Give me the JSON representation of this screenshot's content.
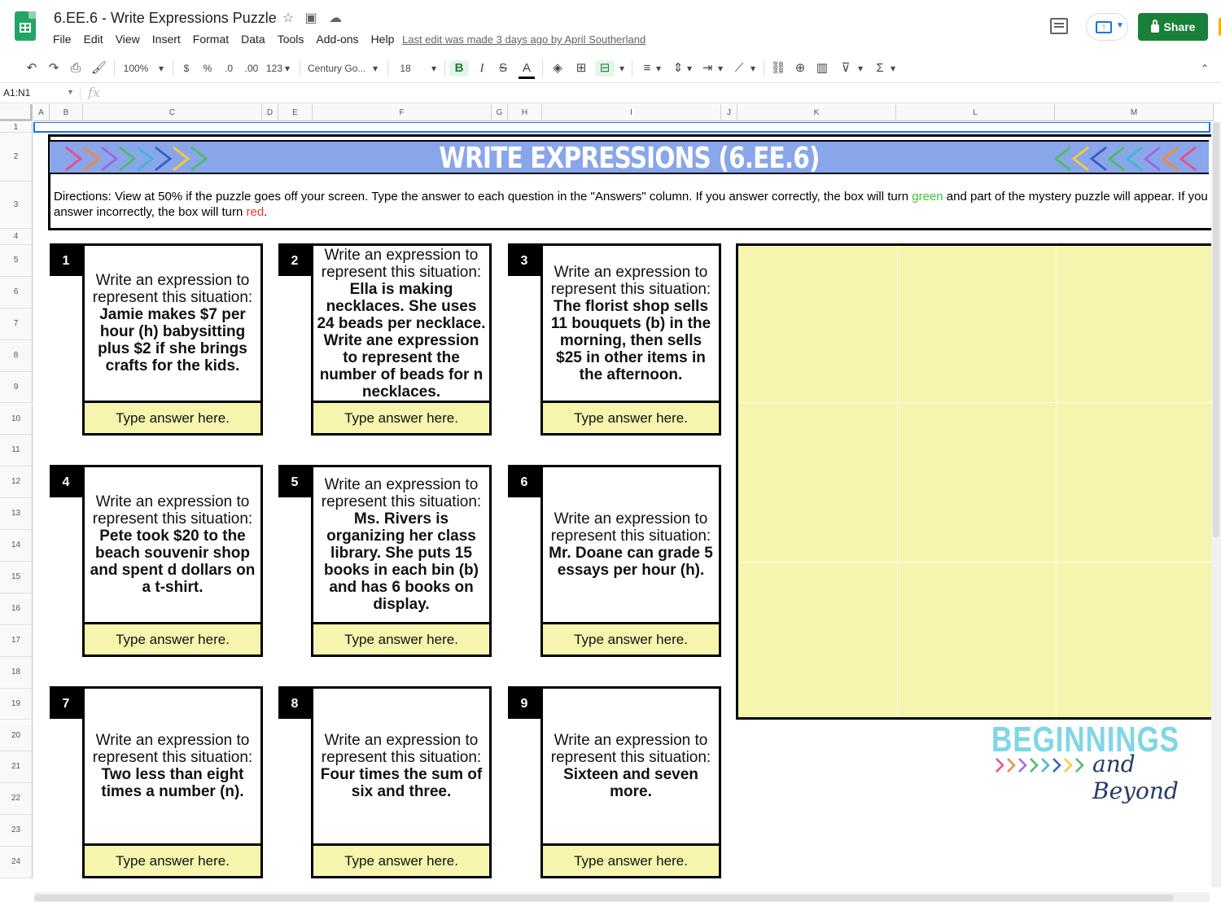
{
  "window": {
    "doc_title": "6.EE.6 - Write Expressions Puzzle",
    "menu": [
      "File",
      "Edit",
      "View",
      "Insert",
      "Format",
      "Data",
      "Tools",
      "Add-ons",
      "Help"
    ],
    "last_edit": "Last edit was made 3 days ago by April Southerland",
    "share_label": "Share",
    "present_icon": "present-icon",
    "comment_icon": "comment-icon"
  },
  "toolbar": {
    "zoom": "100%",
    "currency": "$",
    "percent": "%",
    "dec_less": ".0",
    "dec_more": ".00",
    "format_more": "123",
    "font": "Century Go...",
    "font_size": "18",
    "bold": "B",
    "italic": "I",
    "strike": "S",
    "text_color": "A",
    "functions": "Σ"
  },
  "formula_bar": {
    "name_box": "A1:N1",
    "fx": "fx"
  },
  "columns": [
    "A",
    "B",
    "C",
    "D",
    "E",
    "F",
    "G",
    "H",
    "I",
    "J",
    "K",
    "L",
    "M"
  ],
  "rows": [
    "1",
    "2",
    "3",
    "4",
    "5",
    "6",
    "7",
    "8",
    "9",
    "10",
    "11",
    "12",
    "13",
    "14",
    "15",
    "16",
    "17",
    "18",
    "19",
    "20",
    "21",
    "22",
    "23",
    "24"
  ],
  "sheet": {
    "banner_title": "WRITE EXPRESSIONS (6.EE.6)",
    "directions_1": "Directions: View at 50% if the puzzle goes off your screen. Type the answer to each question in the \"Answers\" column. If you answer correctly, the box will turn ",
    "directions_green": "green",
    "directions_2": " and part of the mystery puzzle will appear. If you answer incorrectly, the box will turn ",
    "directions_red": "red",
    "directions_3": ".",
    "lead": "Write an expression to represent this situation:",
    "answer_placeholder": "Type answer here.",
    "cards": [
      {
        "num": "1",
        "question": "Jamie makes $7 per hour (h) babysitting plus $2 if she brings crafts for the kids."
      },
      {
        "num": "2",
        "question": "Ella is making necklaces.  She uses 24 beads per necklace.  Write ane expression to represent the number of beads for n necklaces."
      },
      {
        "num": "3",
        "question": "The florist shop sells 11 bouquets (b) in the morning, then sells $25 in other items in the afternoon."
      },
      {
        "num": "4",
        "question": "Pete took $20 to the beach souvenir shop and spent d dollars on a t-shirt."
      },
      {
        "num": "5",
        "question": "Ms. Rivers is organizing her class library.  She puts 15 books in each bin (b) and has 6 books on display."
      },
      {
        "num": "6",
        "question": "Mr. Doane can grade 5 essays per hour (h)."
      },
      {
        "num": "7",
        "question": "Two less than eight times a number (n)."
      },
      {
        "num": "8",
        "question": "Four times the sum of six and three."
      },
      {
        "num": "9",
        "question": "Sixteen and seven more."
      }
    ],
    "logo_title": "BEGINNINGS",
    "logo_sub": "and Beyond"
  },
  "colors": {
    "banner": "#8aa6ea",
    "answer_fill": "#f6f5ae",
    "share": "#188038",
    "correct": "#3cc63c",
    "incorrect": "#e53935"
  }
}
